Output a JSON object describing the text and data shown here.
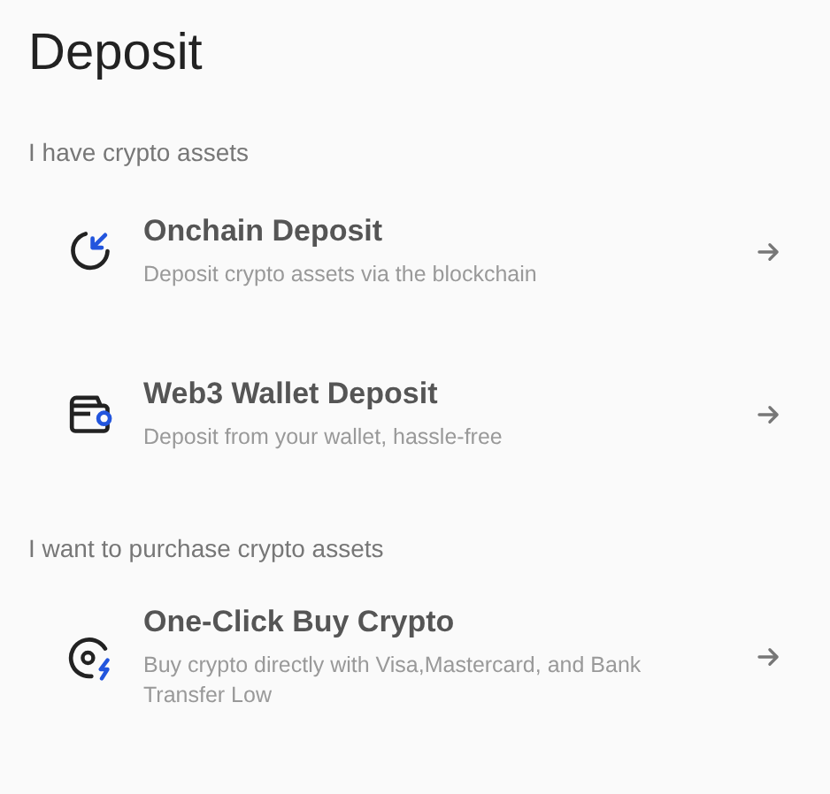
{
  "title": "Deposit",
  "sections": [
    {
      "label": "I have crypto assets",
      "items": [
        {
          "kind": "onchain",
          "title": "Onchain Deposit",
          "description": "Deposit crypto assets via the blockchain"
        },
        {
          "kind": "wallet",
          "title": "Web3 Wallet Deposit",
          "description": "Deposit from your wallet, hassle-free"
        }
      ]
    },
    {
      "label": "I want to purchase crypto assets",
      "items": [
        {
          "kind": "buy",
          "title": "One-Click Buy Crypto",
          "description": "Buy crypto directly with Visa,Mastercard, and Bank Transfer Low"
        }
      ]
    }
  ]
}
